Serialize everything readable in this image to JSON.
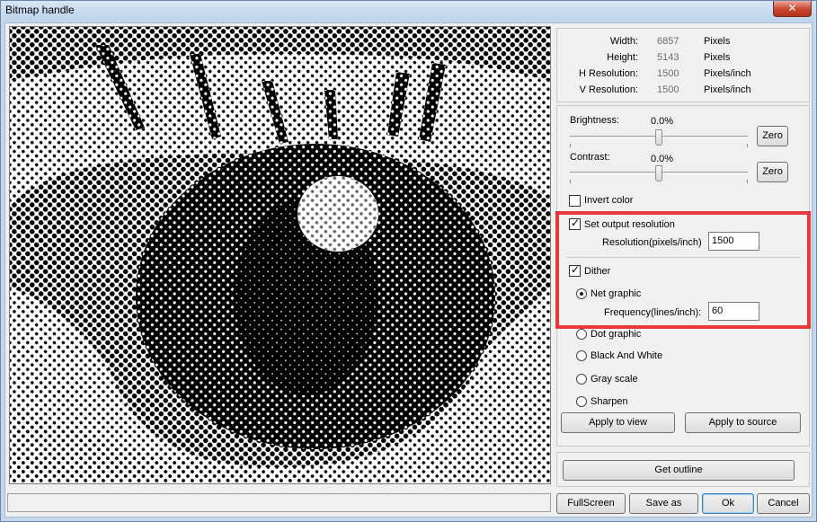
{
  "window": {
    "title": "Bitmap handle",
    "close_label": "✕"
  },
  "image_info": [
    {
      "label": "Width:",
      "value": "6857",
      "unit": "Pixels"
    },
    {
      "label": "Height:",
      "value": "5143",
      "unit": "Pixels"
    },
    {
      "label": "H Resolution:",
      "value": "1500",
      "unit": "Pixels/inch"
    },
    {
      "label": "V Resolution:",
      "value": "1500",
      "unit": "Pixels/inch"
    }
  ],
  "brightness": {
    "label": "Brightness:",
    "value": "0.0%",
    "zero_label": "Zero",
    "level": 0.5
  },
  "contrast": {
    "label": "Contrast:",
    "value": "0.0%",
    "zero_label": "Zero",
    "level": 0.5
  },
  "invert_color": {
    "label": "Invert color",
    "checked": false
  },
  "output_resolution": {
    "label": "Set output resolution",
    "checked": true,
    "field_label": "Resolution(pixels/inch)",
    "value": "1500"
  },
  "dither": {
    "label": "Dither",
    "checked": true,
    "options": [
      "Net graphic",
      "Dot graphic",
      "Black And White",
      "Gray scale",
      "Sharpen"
    ],
    "selected": "Net graphic",
    "frequency_label": "Frequency(lines/inch):",
    "frequency_value": "60"
  },
  "actions": {
    "apply_view": "Apply to view",
    "apply_source": "Apply to source",
    "get_outline": "Get outline"
  },
  "footer": {
    "fullscreen": "FullScreen",
    "save_as": "Save as",
    "ok": "Ok",
    "cancel": "Cancel"
  },
  "colors": {
    "highlight": "#e8383a",
    "title_bg": "#c4d6ec"
  }
}
